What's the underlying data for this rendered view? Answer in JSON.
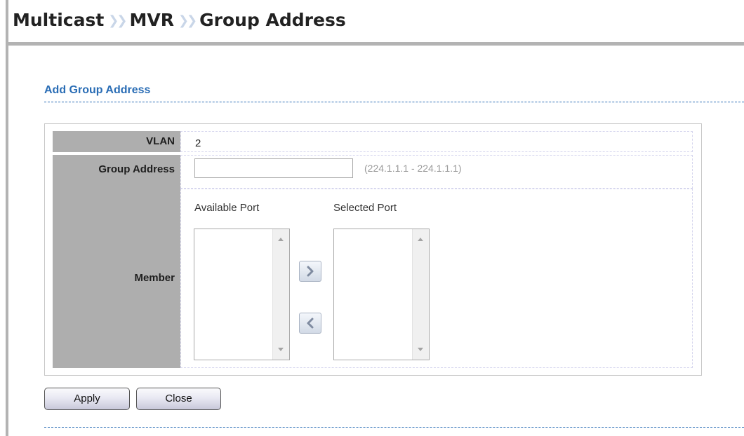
{
  "breadcrumb": {
    "items": [
      "Multicast",
      "MVR",
      "Group Address"
    ],
    "separator": "❯❯"
  },
  "section": {
    "title": "Add Group Address"
  },
  "form": {
    "vlan": {
      "label": "VLAN",
      "value": "2"
    },
    "group_address": {
      "label": "Group Address",
      "value": "",
      "hint": "(224.1.1.1 - 224.1.1.1)"
    },
    "member": {
      "label": "Member",
      "available_label": "Available Port",
      "selected_label": "Selected Port",
      "available_ports": [],
      "selected_ports": []
    }
  },
  "buttons": {
    "apply": "Apply",
    "close": "Close"
  },
  "colors": {
    "accent": "#2a6db5",
    "label_bg": "#aeaeae",
    "hint": "#9a9a9a"
  },
  "icons": {
    "move_right": "chevron-right-icon",
    "move_left": "chevron-left-icon"
  }
}
